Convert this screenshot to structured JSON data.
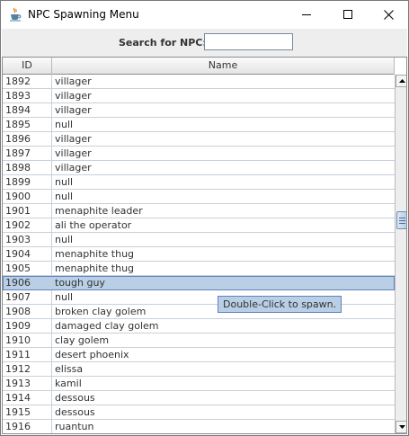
{
  "window": {
    "title": "NPC Spawning Menu"
  },
  "search": {
    "label": "Search for NPC:",
    "value": "",
    "placeholder": ""
  },
  "table": {
    "columns": [
      "ID",
      "Name"
    ],
    "selected_id": "1906",
    "rows": [
      {
        "id": "1892",
        "name": "villager"
      },
      {
        "id": "1893",
        "name": "villager"
      },
      {
        "id": "1894",
        "name": "villager"
      },
      {
        "id": "1895",
        "name": "null"
      },
      {
        "id": "1896",
        "name": "villager"
      },
      {
        "id": "1897",
        "name": "villager"
      },
      {
        "id": "1898",
        "name": "villager"
      },
      {
        "id": "1899",
        "name": "null"
      },
      {
        "id": "1900",
        "name": "null"
      },
      {
        "id": "1901",
        "name": "menaphite leader"
      },
      {
        "id": "1902",
        "name": "ali the operator"
      },
      {
        "id": "1903",
        "name": "null"
      },
      {
        "id": "1904",
        "name": "menaphite thug"
      },
      {
        "id": "1905",
        "name": "menaphite thug"
      },
      {
        "id": "1906",
        "name": "tough guy"
      },
      {
        "id": "1907",
        "name": "null"
      },
      {
        "id": "1908",
        "name": "broken clay golem"
      },
      {
        "id": "1909",
        "name": "damaged clay golem"
      },
      {
        "id": "1910",
        "name": "clay golem"
      },
      {
        "id": "1911",
        "name": "desert phoenix"
      },
      {
        "id": "1912",
        "name": "elissa"
      },
      {
        "id": "1913",
        "name": "kamil"
      },
      {
        "id": "1914",
        "name": "dessous"
      },
      {
        "id": "1915",
        "name": "dessous"
      },
      {
        "id": "1916",
        "name": "ruantun"
      }
    ]
  },
  "tooltip": {
    "text": "Double-Click to spawn."
  },
  "icons": {
    "app": "java-cup-icon",
    "minimize": "minimize-icon",
    "maximize": "maximize-icon",
    "close": "close-icon",
    "scroll_up": "scroll-up-arrow-icon",
    "scroll_down": "scroll-down-arrow-icon"
  },
  "colors": {
    "selection": "#b8cfe5",
    "selection_border": "#6382bf",
    "panel_background": "#eeeeee"
  }
}
